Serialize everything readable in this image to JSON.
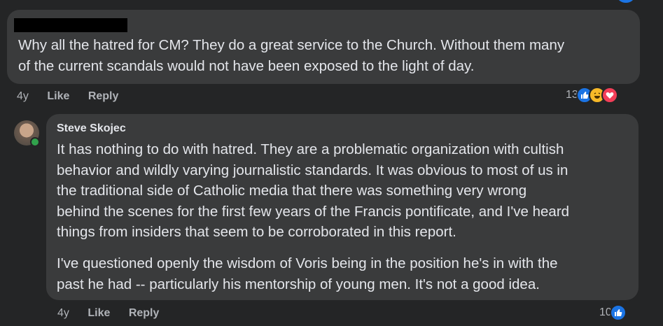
{
  "comment1": {
    "text_lines": [
      "Why all the hatred for CM? They do a great service to the Church. Without them many",
      "of the current scandals would not have been exposed to the light of day."
    ],
    "age": "4y",
    "like_label": "Like",
    "reply_label": "Reply",
    "reaction_count": "13",
    "reactions": [
      "like-icon",
      "haha-icon",
      "love-icon"
    ]
  },
  "comment2": {
    "author": "Steve Skojec",
    "paragraph1_lines": [
      "It has nothing to do with hatred. They are a problematic organization with cultish",
      "behavior and wildly varying journalistic standards. It was obvious to most of us in",
      "the traditional side of Catholic media that there was something very wrong",
      "behind the scenes for the first few years of the Francis pontificate, and I've heard",
      "things from insiders that seem to be corroborated in this report."
    ],
    "paragraph2_lines": [
      "I've questioned openly the wisdom of Voris being in the position he's in with the",
      "past he had -- particularly his mentorship of young men. It's not a good idea."
    ],
    "age": "4y",
    "like_label": "Like",
    "reply_label": "Reply",
    "reaction_count": "10",
    "reactions": [
      "like-icon"
    ]
  },
  "colors": {
    "background": "#242526",
    "bubble": "#3a3b3c",
    "like": "#1b74e4",
    "haha": "#f7b928",
    "love": "#f33e58",
    "online": "#31a24c"
  }
}
